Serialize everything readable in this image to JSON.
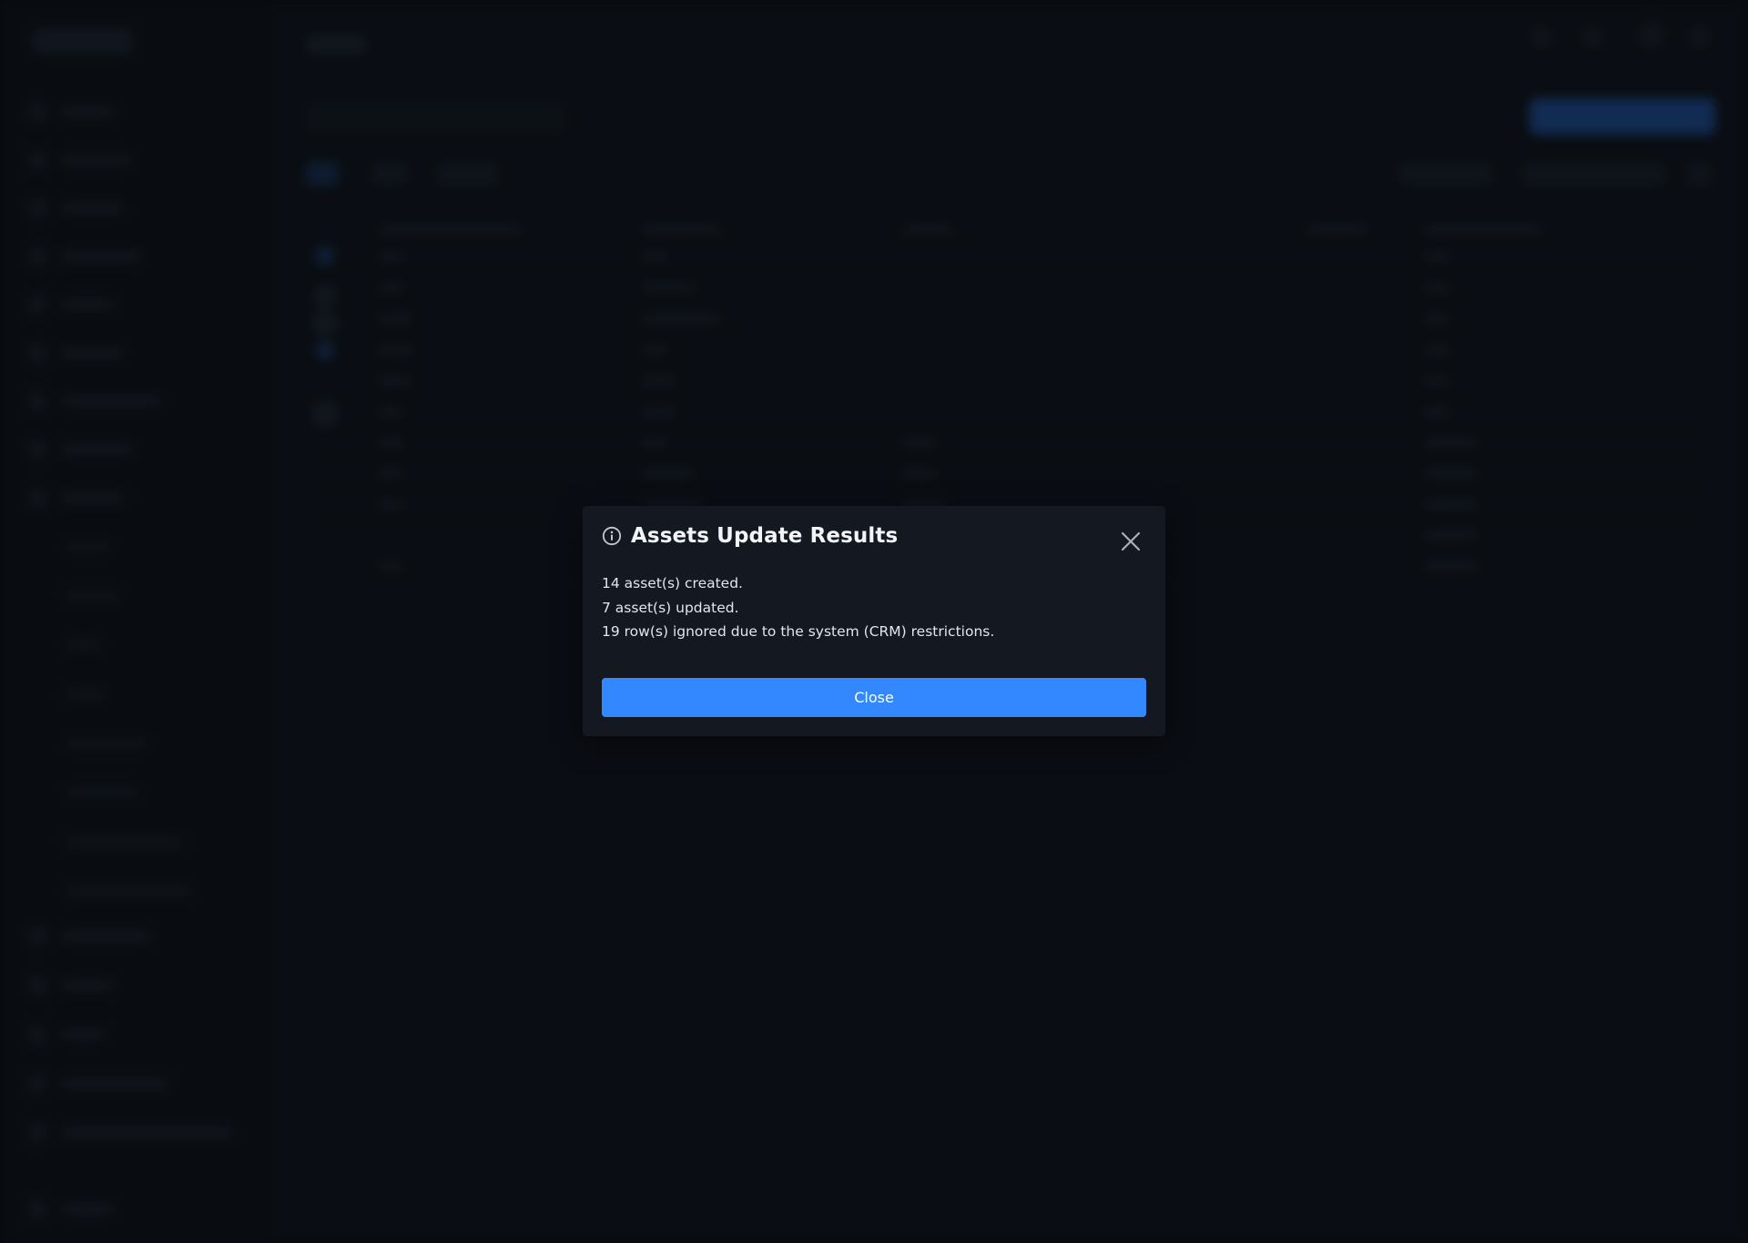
{
  "dialog": {
    "title": "Assets Update Results",
    "icon": "info-icon",
    "messages": [
      "14 asset(s) created.",
      "7 asset(s) updated.",
      "19 row(s) ignored due to the system (CRM) restrictions."
    ],
    "close_label": "Close",
    "colors": {
      "accent": "#3388ff",
      "background": "#131821",
      "text": "#e3e6eb"
    }
  }
}
